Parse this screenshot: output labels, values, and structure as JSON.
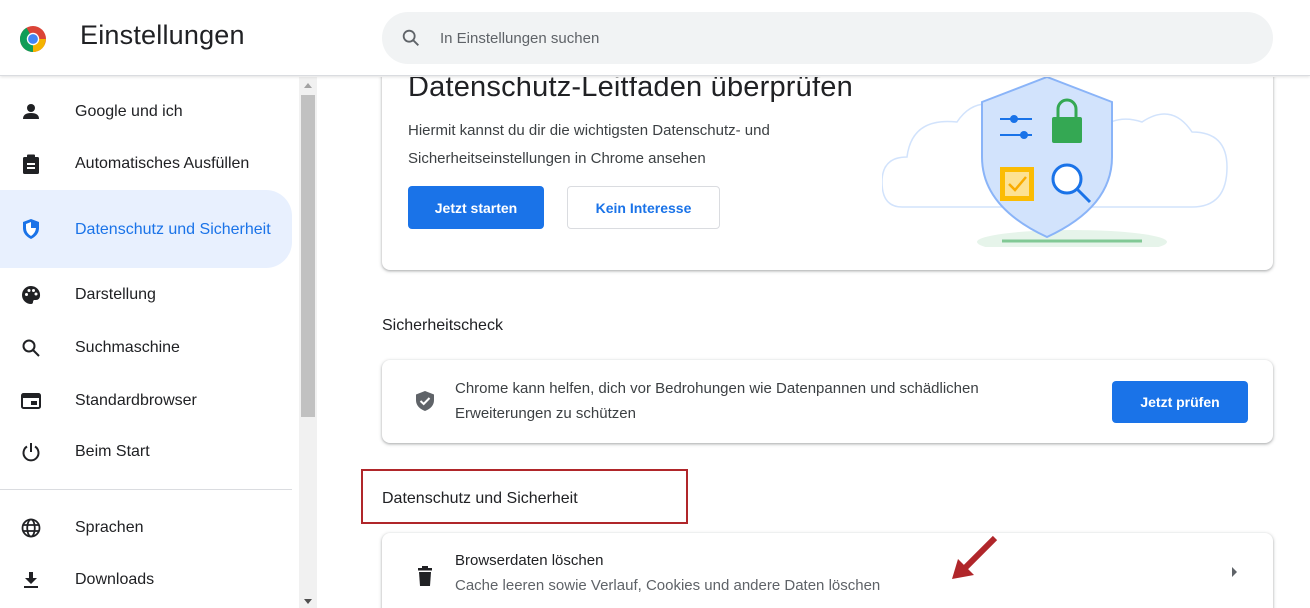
{
  "header": {
    "title": "Einstellungen",
    "search_placeholder": "In Einstellungen suchen"
  },
  "sidebar": {
    "items": [
      {
        "label": "Google und ich",
        "icon": "person-icon"
      },
      {
        "label": "Automatisches Ausfüllen",
        "icon": "clipboard-icon"
      },
      {
        "label": "Datenschutz und Sicherheit",
        "icon": "shield-icon",
        "active": true
      },
      {
        "label": "Darstellung",
        "icon": "palette-icon"
      },
      {
        "label": "Suchmaschine",
        "icon": "search-icon"
      },
      {
        "label": "Standardbrowser",
        "icon": "browser-icon"
      },
      {
        "label": "Beim Start",
        "icon": "power-icon"
      },
      {
        "label": "Sprachen",
        "icon": "globe-icon"
      },
      {
        "label": "Downloads",
        "icon": "download-icon"
      }
    ]
  },
  "guide": {
    "title": "Datenschutz-Leitfaden überprüfen",
    "description": "Hiermit kannst du dir die wichtigsten Datenschutz- und Sicherheitseinstellungen in Chrome ansehen",
    "start_label": "Jetzt starten",
    "dismiss_label": "Kein Interesse"
  },
  "safety_check": {
    "section_title": "Sicherheitscheck",
    "text": "Chrome kann helfen, dich vor Bedrohungen wie Datenpannen und schädlichen Erweiterungen zu schützen",
    "button_label": "Jetzt prüfen"
  },
  "privacy": {
    "section_title": "Datenschutz und Sicherheit",
    "clear_data_title": "Browserdaten löschen",
    "clear_data_subtitle": "Cache leeren sowie Verlauf, Cookies und andere Daten löschen"
  },
  "colors": {
    "accent": "#1a73e8",
    "active_bg": "#e8f0fe",
    "annotation_red": "#b0262a"
  }
}
